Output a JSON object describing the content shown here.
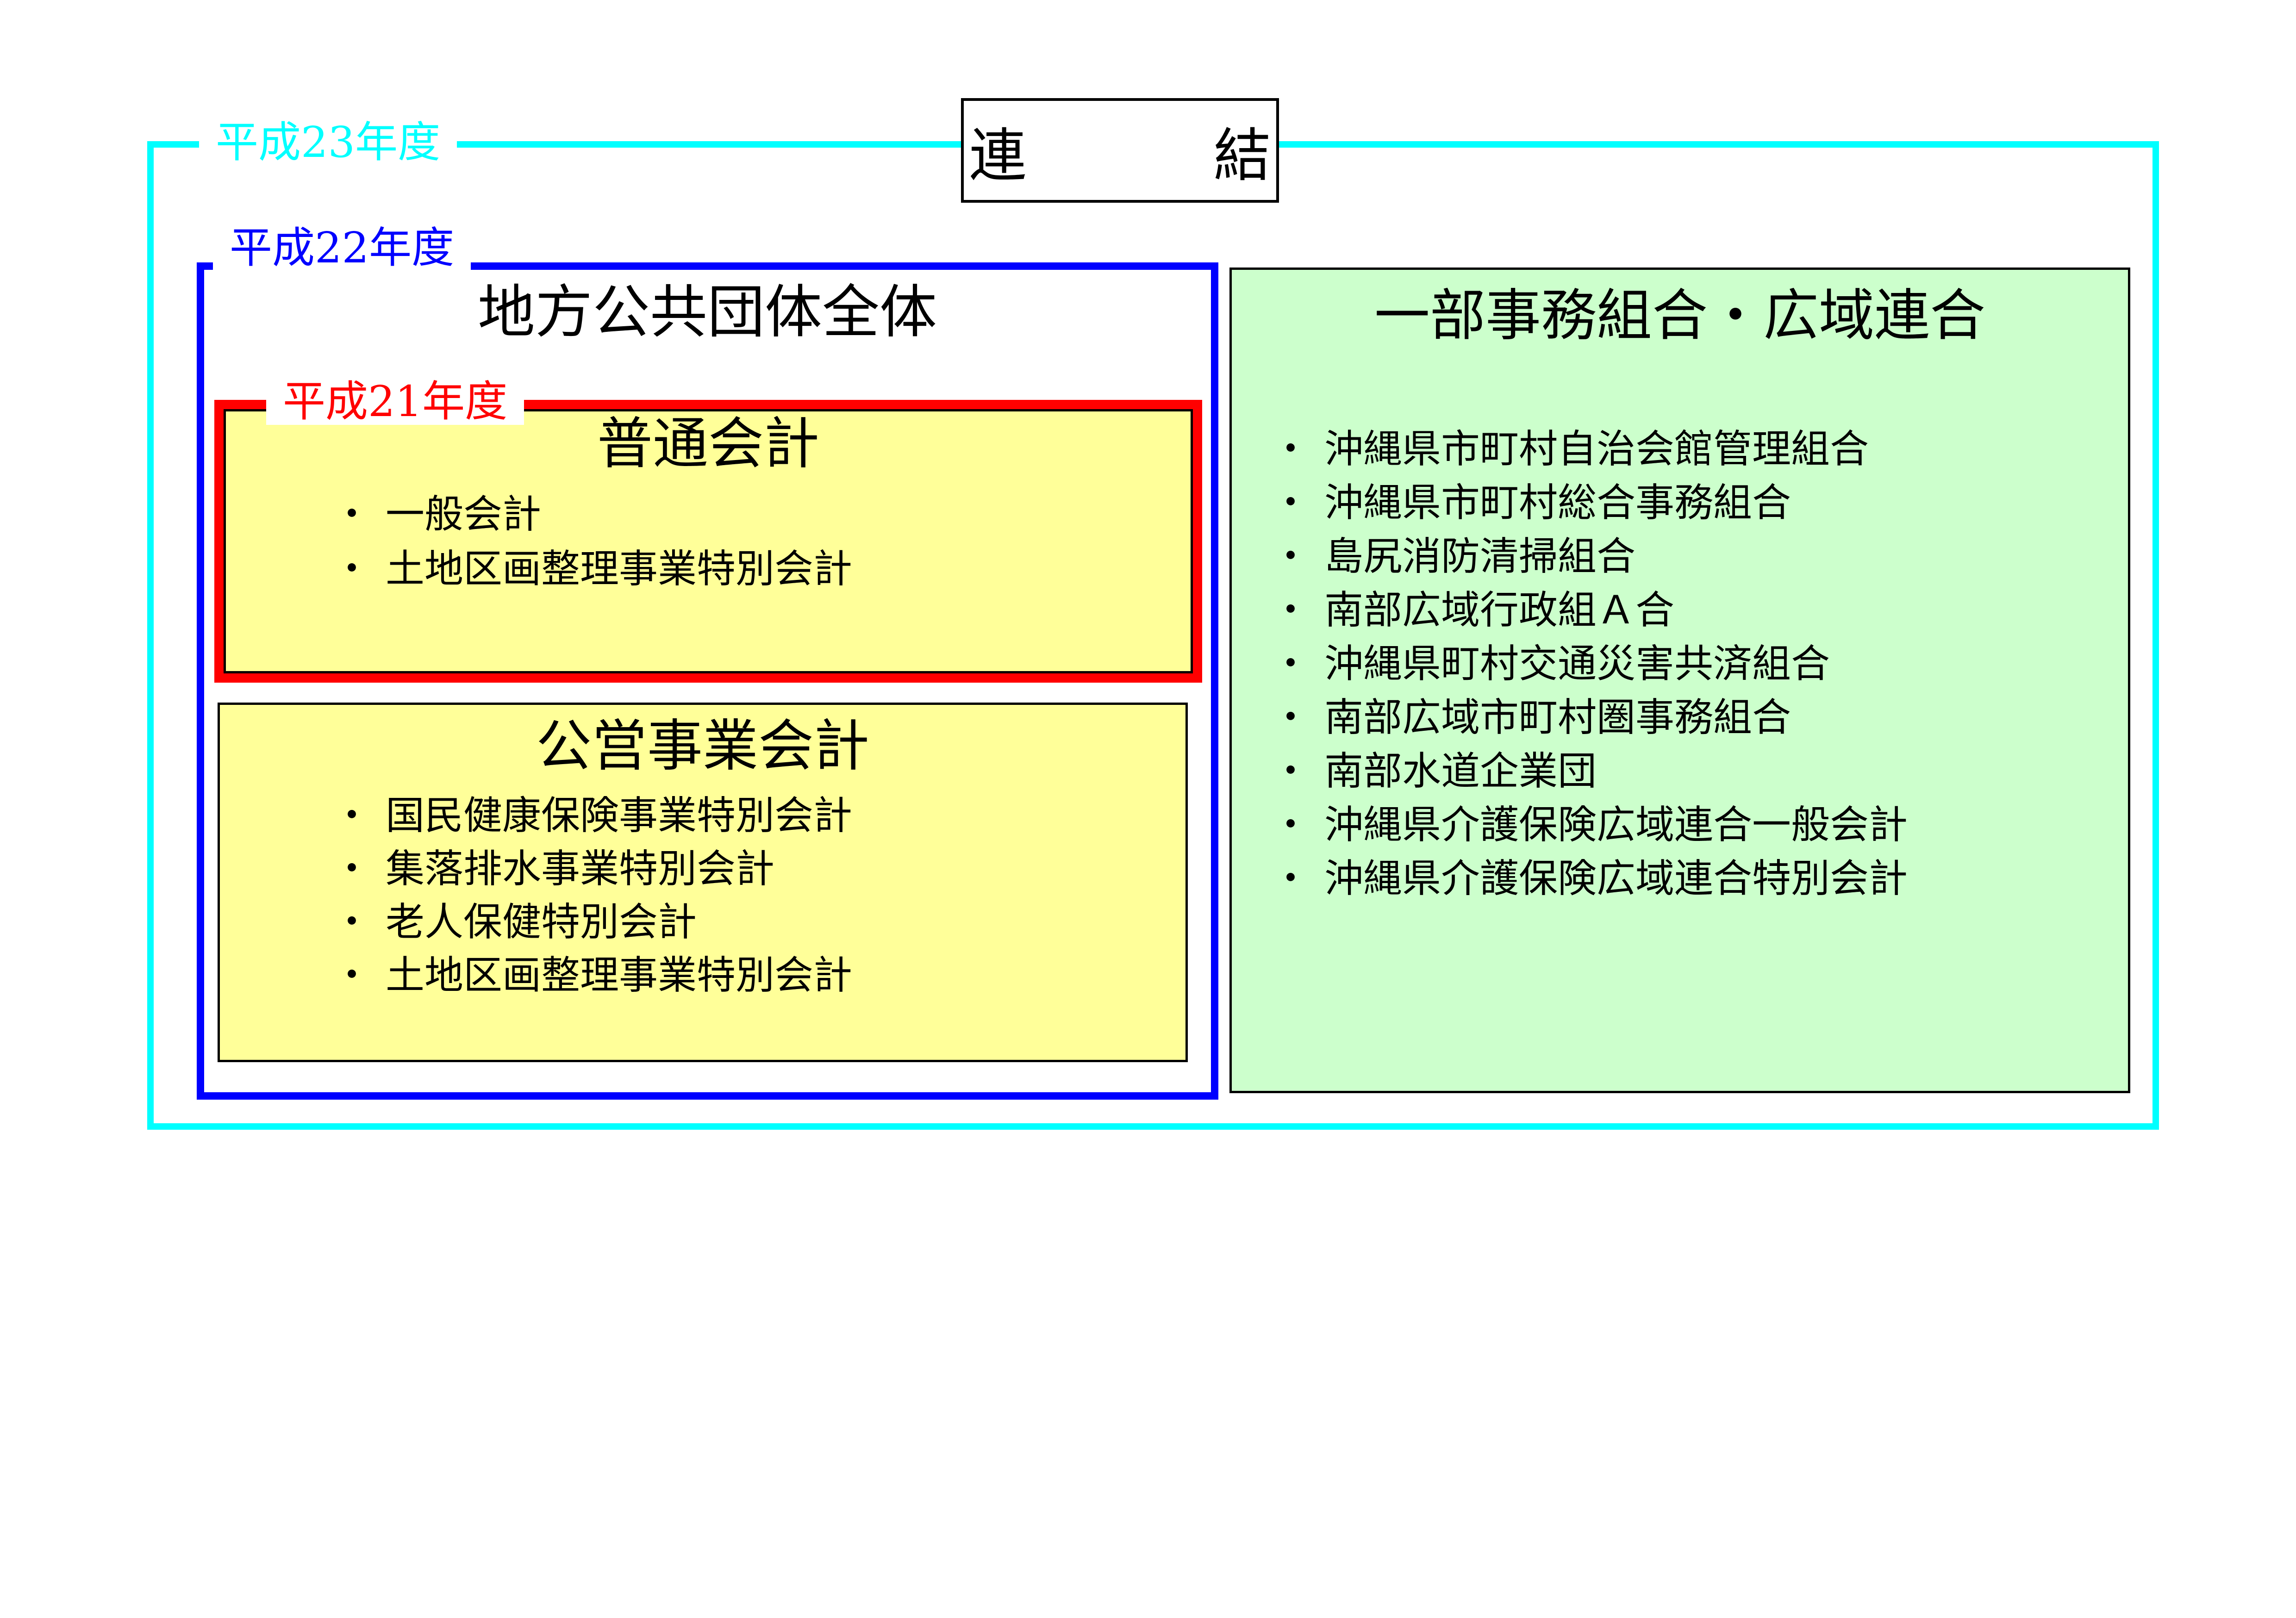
{
  "header": {
    "consolidation": "連　結"
  },
  "frames": {
    "h23_label": "平成23年度",
    "h22_label": "平成22年度",
    "h21_label": "平成21年度"
  },
  "colors": {
    "h23": "#00ffff",
    "h22": "#0000ff",
    "h21": "#ff0000",
    "account_fill": "#ffff99",
    "union_fill": "#ccffcc"
  },
  "whole": {
    "title": "地方公共団体全体"
  },
  "general_account": {
    "title": "普通会計",
    "items": [
      "一般会計",
      "土地区画整理事業特別会計"
    ]
  },
  "public_enterprise": {
    "title": "公営事業会計",
    "items": [
      "国民健康保険事業特別会計",
      "集落排水事業特別会計",
      "老人保健特別会計",
      "土地区画整理事業特別会計"
    ]
  },
  "unions": {
    "title": "一部事務組合・広域連合",
    "items": [
      "沖縄県市町村自治会館管理組合",
      "沖縄県市町村総合事務組合",
      "島尻消防清掃組合",
      "南部広域行政組Ａ合",
      "沖縄県町村交通災害共済組合",
      "南部広域市町村圏事務組合",
      "南部水道企業団",
      "沖縄県介護保険広域連合一般会計",
      "沖縄県介護保険広域連合特別会計"
    ]
  },
  "bullet": "・"
}
